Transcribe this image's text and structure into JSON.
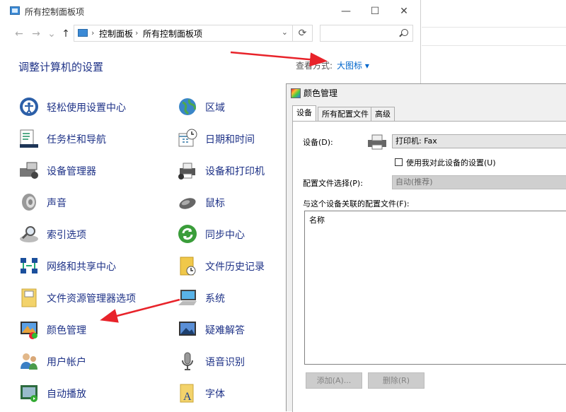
{
  "control_panel": {
    "title": "所有控制面板项",
    "breadcrumb": [
      "控制面板",
      "所有控制面板项"
    ],
    "heading": "调整计算机的设置",
    "view_by_label": "查看方式:",
    "view_by_value": "大图标",
    "items_left": [
      {
        "label": "轻松使用设置中心",
        "icon": "ease-of-access-icon"
      },
      {
        "label": "任务栏和导航",
        "icon": "taskbar-icon"
      },
      {
        "label": "设备管理器",
        "icon": "device-manager-icon"
      },
      {
        "label": "声音",
        "icon": "speaker-icon"
      },
      {
        "label": "索引选项",
        "icon": "indexing-icon"
      },
      {
        "label": "网络和共享中心",
        "icon": "network-icon"
      },
      {
        "label": "文件资源管理器选项",
        "icon": "folder-options-icon"
      },
      {
        "label": "颜色管理",
        "icon": "color-management-icon"
      },
      {
        "label": "用户帐户",
        "icon": "users-icon"
      },
      {
        "label": "自动播放",
        "icon": "autoplay-icon"
      }
    ],
    "items_right": [
      {
        "label": "区域",
        "icon": "globe-icon"
      },
      {
        "label": "日期和时间",
        "icon": "calendar-clock-icon"
      },
      {
        "label": "设备和打印机",
        "icon": "printer-icon"
      },
      {
        "label": "鼠标",
        "icon": "mouse-icon"
      },
      {
        "label": "同步中心",
        "icon": "sync-icon"
      },
      {
        "label": "文件历史记录",
        "icon": "file-history-icon"
      },
      {
        "label": "系统",
        "icon": "computer-icon"
      },
      {
        "label": "疑难解答",
        "icon": "troubleshoot-icon"
      },
      {
        "label": "语音识别",
        "icon": "microphone-icon"
      },
      {
        "label": "字体",
        "icon": "font-icon"
      }
    ]
  },
  "color_dialog": {
    "title": "颜色管理",
    "tabs": [
      "设备",
      "所有配置文件",
      "高级"
    ],
    "device_label": "设备(D):",
    "device_value": "打印机: Fax",
    "use_my_settings": "使用我对此设备的设置(U)",
    "profile_selection_label": "配置文件选择(P):",
    "profile_selection_value": "自动(推荐)",
    "associated_profiles_label": "与这个设备关联的配置文件(F):",
    "list_column": "名称",
    "add_button": "添加(A)...",
    "remove_button": "删除(R)"
  },
  "colors": {
    "link": "#1e3287",
    "arrow": "#e8232a"
  }
}
